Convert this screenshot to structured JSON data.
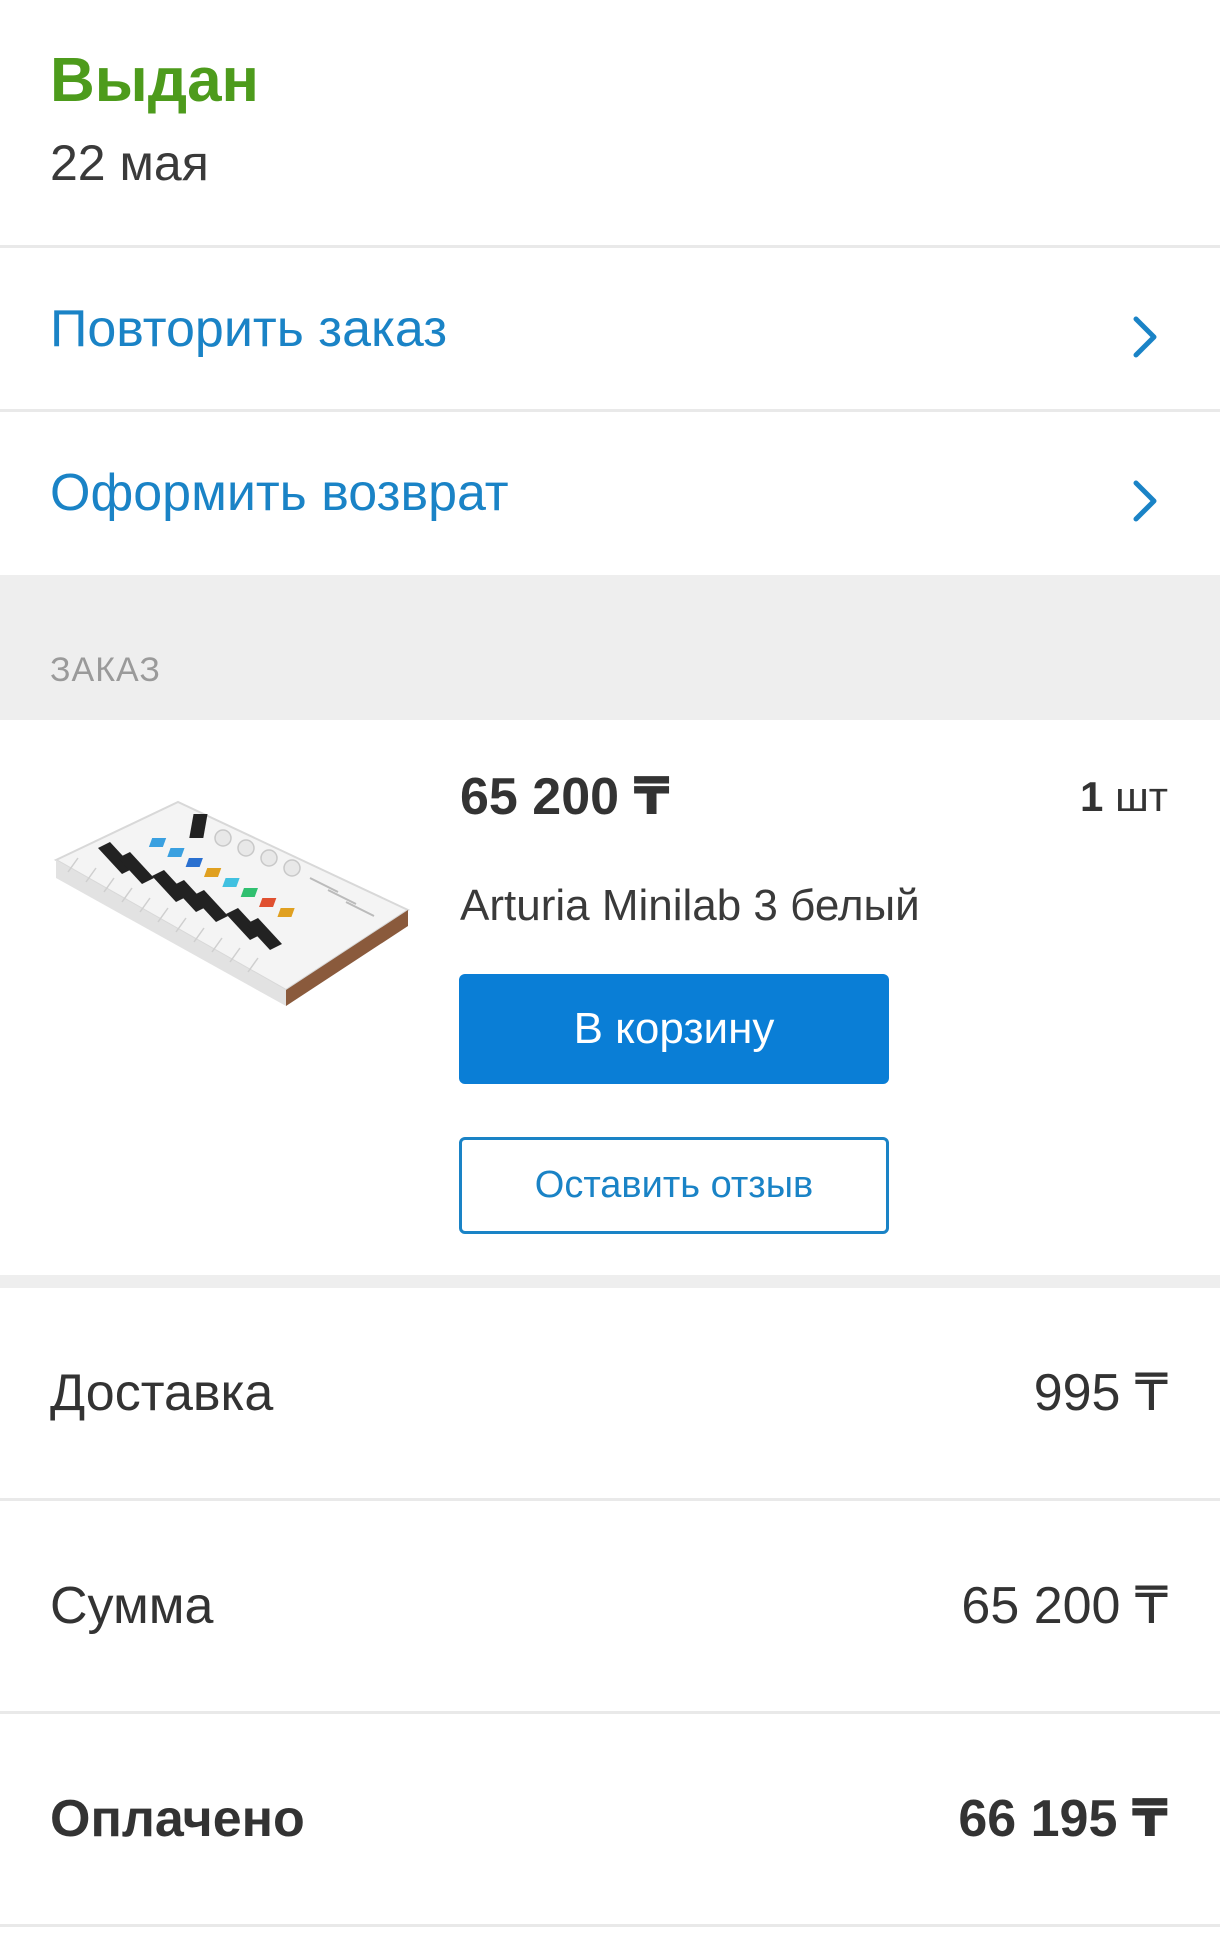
{
  "status": {
    "title": "Выдан",
    "date": "22 мая",
    "color": "#4d9b1c"
  },
  "actions": [
    {
      "label": "Повторить заказ",
      "icon": "chevron-right-icon"
    },
    {
      "label": "Оформить возврат",
      "icon": "chevron-right-icon"
    }
  ],
  "section": {
    "label": "ЗАКАЗ"
  },
  "product": {
    "price": "65 200 ₸",
    "quantity_number": "1",
    "quantity_unit": "шт",
    "name": "Arturia Minilab 3 белый",
    "image": "midi-keyboard-image",
    "cart_button": "В корзину",
    "review_button": "Оставить отзыв"
  },
  "summary": {
    "delivery_label": "Доставка",
    "delivery_value": "995 ₸",
    "sum_label": "Сумма",
    "sum_value": "65 200 ₸",
    "paid_label": "Оплачено",
    "paid_value": "66 195 ₸"
  },
  "colors": {
    "accent": "#1a83c6",
    "primary_button": "#0a7ed6",
    "status_green": "#4d9b1c"
  }
}
